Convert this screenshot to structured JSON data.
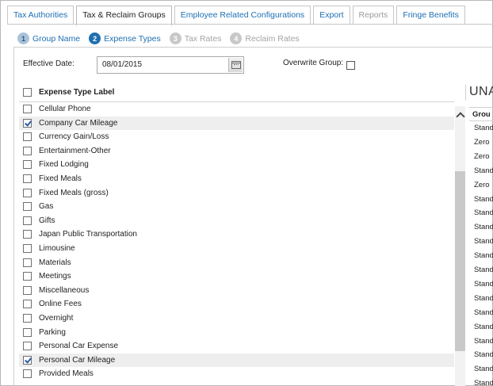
{
  "tabs": [
    {
      "label": "Tax Authorities",
      "state": "link"
    },
    {
      "label": "Tax & Reclaim Groups",
      "state": "active"
    },
    {
      "label": "Employee Related Configurations",
      "state": "link"
    },
    {
      "label": "Export",
      "state": "link"
    },
    {
      "label": "Reports",
      "state": "disabled"
    },
    {
      "label": "Fringe Benefits",
      "state": "link"
    }
  ],
  "steps": [
    {
      "num": "1",
      "label": "Group Name",
      "state": "done"
    },
    {
      "num": "2",
      "label": "Expense Types",
      "state": "current"
    },
    {
      "num": "3",
      "label": "Tax Rates",
      "state": "future"
    },
    {
      "num": "4",
      "label": "Reclaim Rates",
      "state": "future"
    }
  ],
  "form": {
    "effective_date_label": "Effective Date:",
    "effective_date_value": "08/01/2015",
    "overwrite_group_label": "Overwrite Group:",
    "overwrite_group_checked": false
  },
  "expense_list": {
    "header": "Expense Type Label",
    "rows": [
      {
        "label": "Cellular Phone",
        "checked": false
      },
      {
        "label": "Company Car Mileage",
        "checked": true
      },
      {
        "label": "Currency Gain/Loss",
        "checked": false
      },
      {
        "label": "Entertainment-Other",
        "checked": false
      },
      {
        "label": "Fixed Lodging",
        "checked": false
      },
      {
        "label": "Fixed Meals",
        "checked": false
      },
      {
        "label": "Fixed Meals (gross)",
        "checked": false
      },
      {
        "label": "Gas",
        "checked": false
      },
      {
        "label": "Gifts",
        "checked": false
      },
      {
        "label": "Japan Public Transportation",
        "checked": false
      },
      {
        "label": "Limousine",
        "checked": false
      },
      {
        "label": "Materials",
        "checked": false
      },
      {
        "label": "Meetings",
        "checked": false
      },
      {
        "label": "Miscellaneous",
        "checked": false
      },
      {
        "label": "Online Fees",
        "checked": false
      },
      {
        "label": "Overnight",
        "checked": false
      },
      {
        "label": "Parking",
        "checked": false
      },
      {
        "label": "Personal Car Expense",
        "checked": false
      },
      {
        "label": "Personal Car Mileage",
        "checked": true
      },
      {
        "label": "Provided Meals",
        "checked": false
      }
    ]
  },
  "right_panel": {
    "title": "UNA",
    "column_header": "Grou",
    "cells": [
      "Stand",
      "Zero",
      "Zero",
      "Stand",
      "Zero",
      "Stand",
      "Stand",
      "Stand",
      "Stand",
      "Stand",
      "Stand",
      "Stand",
      "Stand",
      "Stand",
      "Stand",
      "Stand",
      "Stand",
      "Stand",
      "Stand",
      "Stand"
    ]
  }
}
